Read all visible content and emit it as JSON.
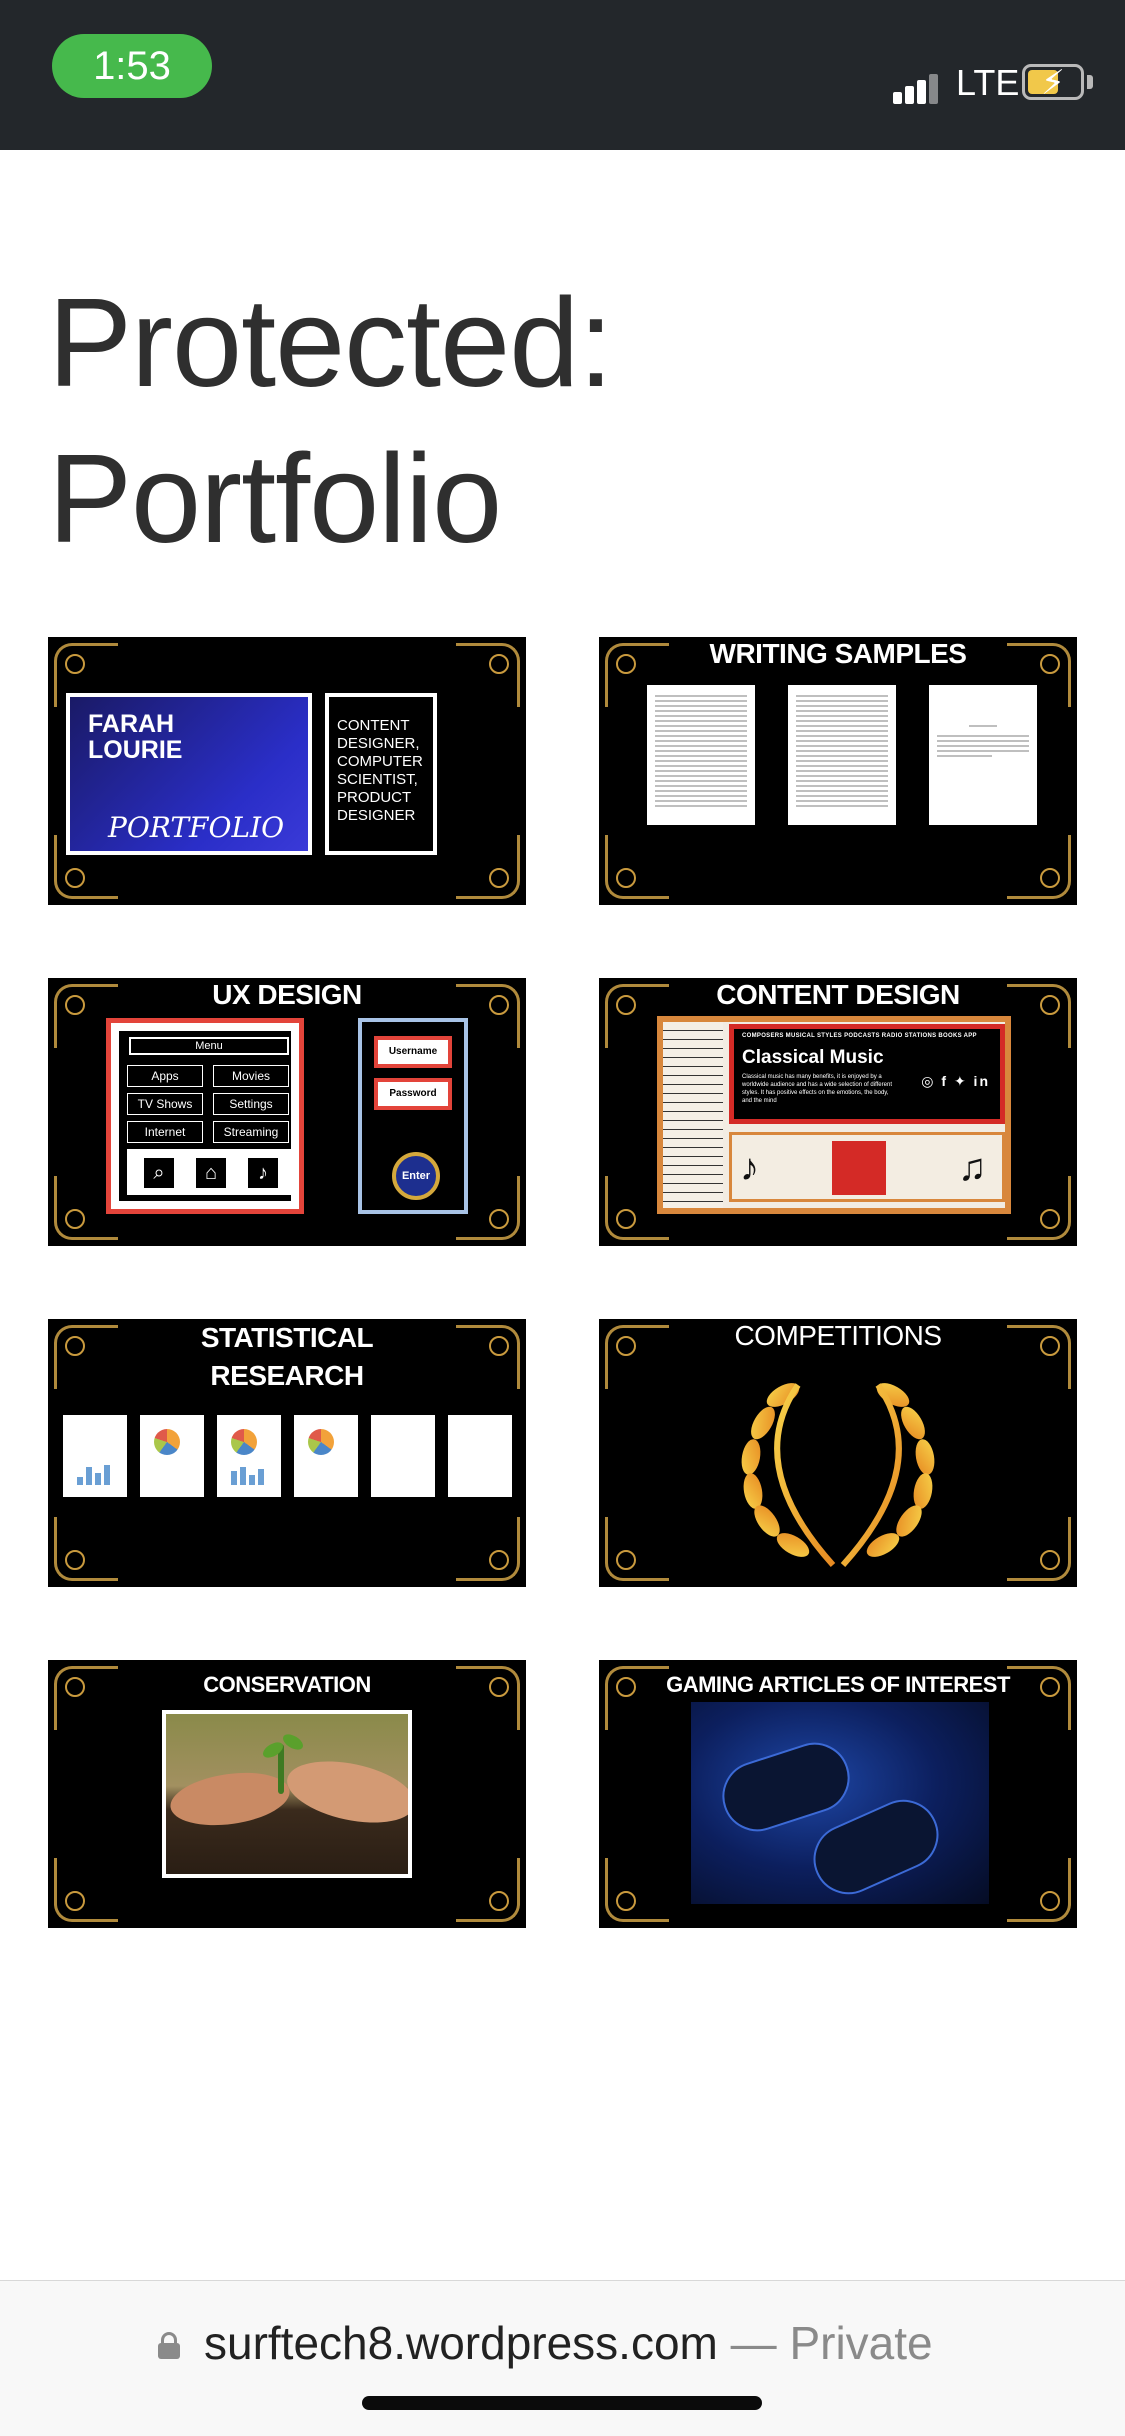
{
  "status_bar": {
    "time": "1:53",
    "network": "LTE",
    "icons": [
      "signal-icon",
      "battery-charging-icon"
    ]
  },
  "page": {
    "title_line1": "Protected:",
    "title_line2": "Portfolio"
  },
  "cards": {
    "portfolio": {
      "name_line1": "FARAH",
      "name_line2": "LOURIE",
      "portfolio_label": "PORTFOLIO",
      "roles": [
        "CONTENT",
        "DESIGNER,",
        "COMPUTER",
        "SCIENTIST,",
        "PRODUCT",
        "DESIGNER"
      ]
    },
    "writing": {
      "title": "WRITING SAMPLES"
    },
    "ux": {
      "title": "UX DESIGN",
      "menu": "Menu",
      "buttons": [
        "Apps",
        "Movies",
        "TV Shows",
        "Settings",
        "Internet",
        "Streaming"
      ],
      "username": "Username",
      "password": "Password",
      "enter": "Enter"
    },
    "content": {
      "title": "CONTENT DESIGN",
      "nav": "COMPOSERS   MUSICAL STYLES   PODCASTS   RADIO STATIONS   BOOKS   APP",
      "heading": "Classical Music",
      "body": "Classical music has many benefits, it is enjoyed by a worldwide audience and has a wide selection of different styles. It has positive effects on the emotions, the body, and the mind",
      "social": "◎ f ✦ in"
    },
    "stats": {
      "title_line1": "STATISTICAL",
      "title_line2": "RESEARCH"
    },
    "competitions": {
      "title": "COMPETITIONS"
    },
    "conservation": {
      "title": "CONSERVATION"
    },
    "gaming": {
      "title": "GAMING ARTICLES OF INTEREST"
    }
  },
  "address_bar": {
    "domain": "surftech8.wordpress.com",
    "separator": "—",
    "mode": "Private"
  },
  "colors": {
    "status_bar_bg": "#23272b",
    "time_pill": "#46b94c",
    "card_bg": "#000000",
    "gold": "#c99a3e",
    "accent_red": "#e3443a"
  }
}
